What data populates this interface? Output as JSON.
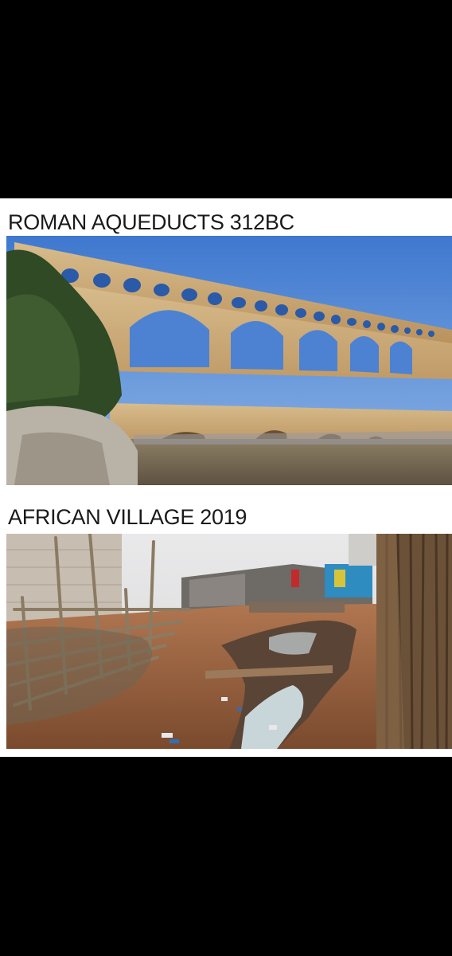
{
  "meme": {
    "top_caption": "ROMAN AQUEDUCTS 312BC",
    "bottom_caption": "AFRICAN VILLAGE 2019",
    "top_photo_subject": "aqueduct-bridge-photo",
    "bottom_photo_subject": "village-slum-photo"
  },
  "colors": {
    "background": "#000000",
    "card": "#ffffff",
    "caption_text": "#1a1a1a",
    "sky": "#5b8fd6",
    "stone": "#c9a773",
    "river": "#7d7058",
    "dirt": "#9a5f3c"
  }
}
